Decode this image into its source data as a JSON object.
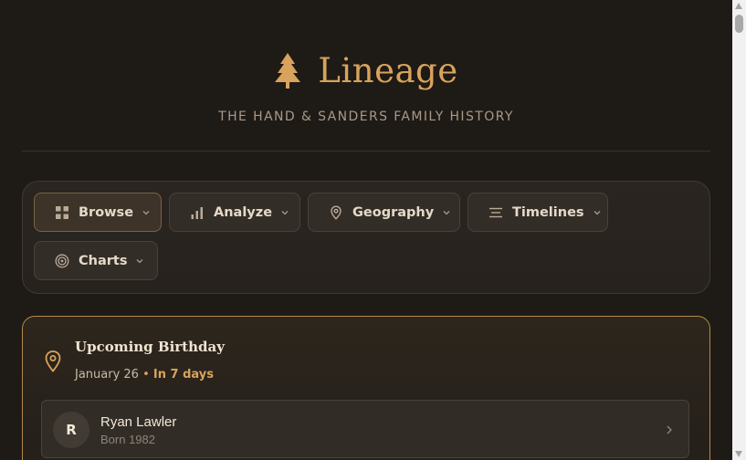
{
  "header": {
    "title": "Lineage",
    "tagline": "THE HAND & SANDERS FAMILY HISTORY",
    "logo_icon": "pine-tree-icon"
  },
  "nav": {
    "items": [
      {
        "label": "Browse",
        "icon": "grid-icon",
        "active": true
      },
      {
        "label": "Analyze",
        "icon": "bar-chart-icon"
      },
      {
        "label": "Geography",
        "icon": "map-pin-icon"
      },
      {
        "label": "Timelines",
        "icon": "timeline-icon"
      },
      {
        "label": "Charts",
        "icon": "target-icon"
      }
    ]
  },
  "birthday": {
    "title": "Upcoming Birthday",
    "date": "January 26",
    "separator": "•",
    "countdown": "In 7 days",
    "icon": "map-pin-icon",
    "person": {
      "initial": "R",
      "name": "Ryan Lawler",
      "born": "Born 1982"
    }
  },
  "colors": {
    "accent": "#d8a35c",
    "background": "#1e1a16",
    "card_border": "#b48a4a"
  }
}
